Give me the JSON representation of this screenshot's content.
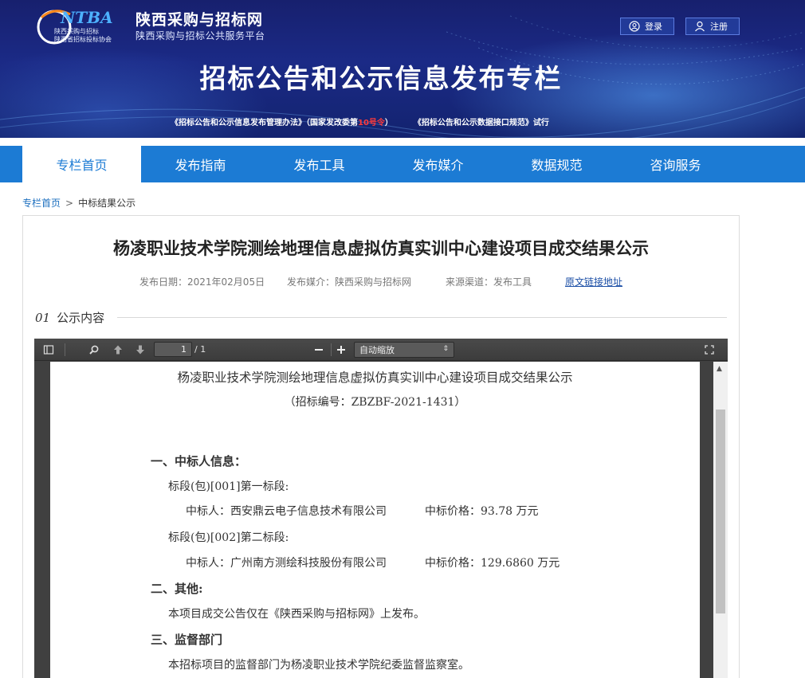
{
  "header": {
    "logo_text": "NTBA",
    "logo_sub1": "陕西采购与招标",
    "logo_sub2": "陕西省招标投标协会",
    "site_name": "陕西采购与招标网",
    "site_sub": "陕西采购与招标公共服务平台",
    "login_label": "登录",
    "register_label": "注册",
    "banner_title": "招标公告和公示信息发布专栏",
    "notice_part1": "《招标公告和公示信息发布管理办法》（国家发改委第",
    "notice_red": "10号令",
    "notice_part2": "）",
    "notice_part3": "《招标公告和公示数据接口规范》试行"
  },
  "nav": {
    "items": [
      "专栏首页",
      "发布指南",
      "发布工具",
      "发布媒介",
      "数据规范",
      "咨询服务"
    ]
  },
  "breadcrumb": {
    "home": "专栏首页",
    "separator": ">",
    "current": "中标结果公示"
  },
  "article": {
    "title": "杨凌职业技术学院测绘地理信息虚拟仿真实训中心建设项目成交结果公示",
    "date": "发布日期：2021年02月05日",
    "media": "发布媒介：陕西采购与招标网",
    "source": "来源渠道：发布工具",
    "link": "原文链接地址",
    "section_num": "01",
    "section_label": "公示内容"
  },
  "viewer": {
    "page_current": "1",
    "page_total": "/ 1",
    "zoom": "自动缩放",
    "doc": {
      "title": "杨凌职业技术学院测绘地理信息虚拟仿真实训中心建设项目成交结果公示",
      "number": "（招标编号：ZBZBF-2021-1431）",
      "h1": "一、中标人信息：",
      "lot1": "标段(包)[001]第一标段:",
      "lot1_winner": "中标人：西安鼎云电子信息技术有限公司",
      "lot1_price": "中标价格：93.78 万元",
      "lot2": "标段(包)[002]第二标段:",
      "lot2_winner": "中标人：广州南方测绘科技股份有限公司",
      "lot2_price": "中标价格：129.6860 万元",
      "h2": "二、其他:",
      "other": "本项目成交公告仅在《陕西采购与招标网》上发布。",
      "h3": "三、监督部门",
      "supervise": "本招标项目的监督部门为杨凌职业技术学院纪委监督监察室。"
    }
  },
  "colors": {
    "banner": "#1b2a86",
    "nav": "#1c7bd4",
    "link": "#1c6fbf",
    "notice_red": "#ff3b3b"
  }
}
